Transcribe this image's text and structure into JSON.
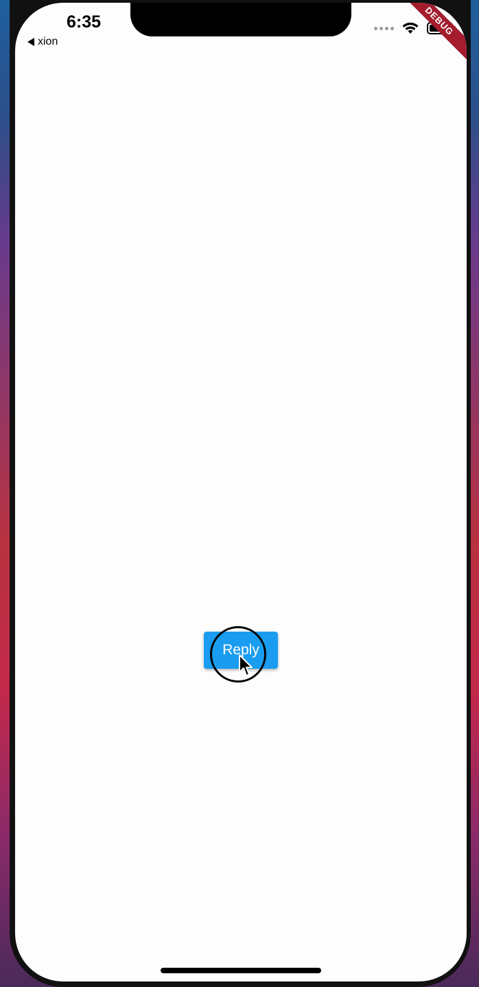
{
  "status_bar": {
    "time": "6:35",
    "back_app": "xion"
  },
  "debug_banner": {
    "label": "DEBUG",
    "color": "#a31d2e"
  },
  "main": {
    "reply_button_label": "Reply",
    "button_color": "#1a9df0"
  },
  "icons": {
    "wifi": "wifi-icon",
    "battery": "battery-icon",
    "back": "back-arrow-icon",
    "cursor": "cursor-icon"
  }
}
